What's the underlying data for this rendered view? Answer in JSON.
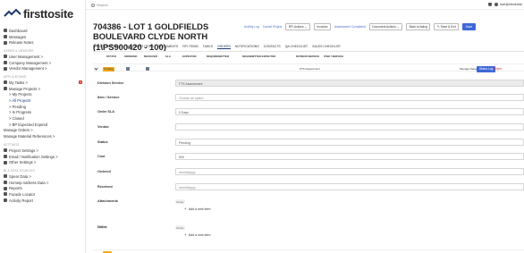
{
  "brand": {
    "name": "firsttosite",
    "reg": "®"
  },
  "topbar": {
    "search_placeholder": "Search",
    "user": "hart@elevinsite"
  },
  "sidebar": {
    "items": [
      {
        "label": "Dashboard",
        "icon": "home-icon"
      },
      {
        "label": "Messages",
        "icon": "envelope-icon"
      },
      {
        "label": "Release Notes",
        "icon": "notes-icon"
      }
    ],
    "sec_users": "USERS & VENDORS",
    "users_items": [
      {
        "label": "User Management  >",
        "icon": "user-icon"
      },
      {
        "label": "Company Management  >",
        "icon": "building-icon"
      },
      {
        "label": "Vendor Management  >",
        "icon": "vendor-icon"
      }
    ],
    "sec_app": "APPLICATIONS",
    "app_items": [
      {
        "label": "My Tasks  >",
        "icon": "tasks-icon",
        "badge": "6"
      },
      {
        "label": "Manage Projects  >",
        "icon": "projects-icon"
      }
    ],
    "project_sub": [
      "> My Projects",
      "> All Projects",
      "> Pending",
      "> In Progress",
      "> Closed",
      "> BP Expected Expired"
    ],
    "manage_items": [
      "Manage Orders  >",
      "Manage Material References  >"
    ],
    "sec_settings": "SETTINGS",
    "settings_items": [
      {
        "label": "Project Settings  >",
        "icon": "gear-icon"
      },
      {
        "label": "Email / Notification Settings  >",
        "icon": "mail-icon"
      },
      {
        "label": "Other Settings  >",
        "icon": "gear-icon"
      }
    ],
    "sec_data": "BI & DATA SOURCES",
    "data_items": [
      {
        "label": "Spear Data  >",
        "icon": "data-icon"
      },
      {
        "label": "Homeip Address Data  >",
        "icon": "data-icon"
      },
      {
        "label": "Reports",
        "icon": "report-icon"
      },
      {
        "label": "Facade Locator",
        "icon": "locator-icon"
      },
      {
        "label": "Activity Report",
        "icon": "activity-icon"
      }
    ]
  },
  "header": {
    "title": "704386 - LOT 1 GOLDFIELDS BOULEVARD CLYDE NORTH (1\\PS900420 - 100)",
    "activity_log": "Activity Log",
    "cancel_project": "Cancel Project",
    "rfi_actions": "RFI Actions",
    "invoices": "Invoices",
    "assessment_completed": "Assessment Completed",
    "document_actions": "Document Actions",
    "back": "Back to listing",
    "save_exit": "Save & Exit",
    "save": "Save"
  },
  "tabs": [
    "PROJECT DETAILS",
    "CHECKLIST ITEMS",
    "DOCUMENTS",
    "RFI ITEMS",
    "TASKS",
    "ORDERS",
    "NOTIFICATIONS",
    "CONTACTS",
    "QA CHECKLIST",
    "SALES CHECKLIST"
  ],
  "table": {
    "headers": [
      "STATUS",
      "ORDERED",
      "RECEIVED",
      "SLA",
      "EXPECTED",
      "REQUIREMETTED",
      "RESUBMITTED EXPECTED",
      "DIVISION SERVICE",
      "ITEM / SERVICE"
    ],
    "row": {
      "status": "Pending",
      "service": "FTS Assessment",
      "manage": "Manage Delays",
      "status_log": "Status Log",
      "reject": "Reject"
    }
  },
  "form": {
    "division_service": {
      "label": "Division Service",
      "value": "FTS Assessment"
    },
    "item_service": {
      "label": "Item / Service",
      "placeholder": "Choose an option"
    },
    "order_sla": {
      "label": "Order SLA",
      "value": "0 Days"
    },
    "vendor": {
      "label": "Vendor",
      "value": ""
    },
    "status": {
      "label": "Status",
      "value": "Pending"
    },
    "cost": {
      "label": "Cost",
      "value": "500"
    },
    "ordered": {
      "label": "Ordered",
      "placeholder": "mm/dd/yyyy"
    },
    "received": {
      "label": "Received",
      "placeholder": "mm/dd/yyyy"
    },
    "attachments": {
      "label": "Attachments",
      "empty": "Empty",
      "add": "Add a new item"
    },
    "notes": {
      "label": "Notes",
      "empty": "Empty",
      "add": "Add a new item"
    }
  },
  "colors": {
    "accent": "#1e3770",
    "blue": "#3d68d8",
    "pending": "#f6a71a",
    "danger": "#e0342c"
  }
}
